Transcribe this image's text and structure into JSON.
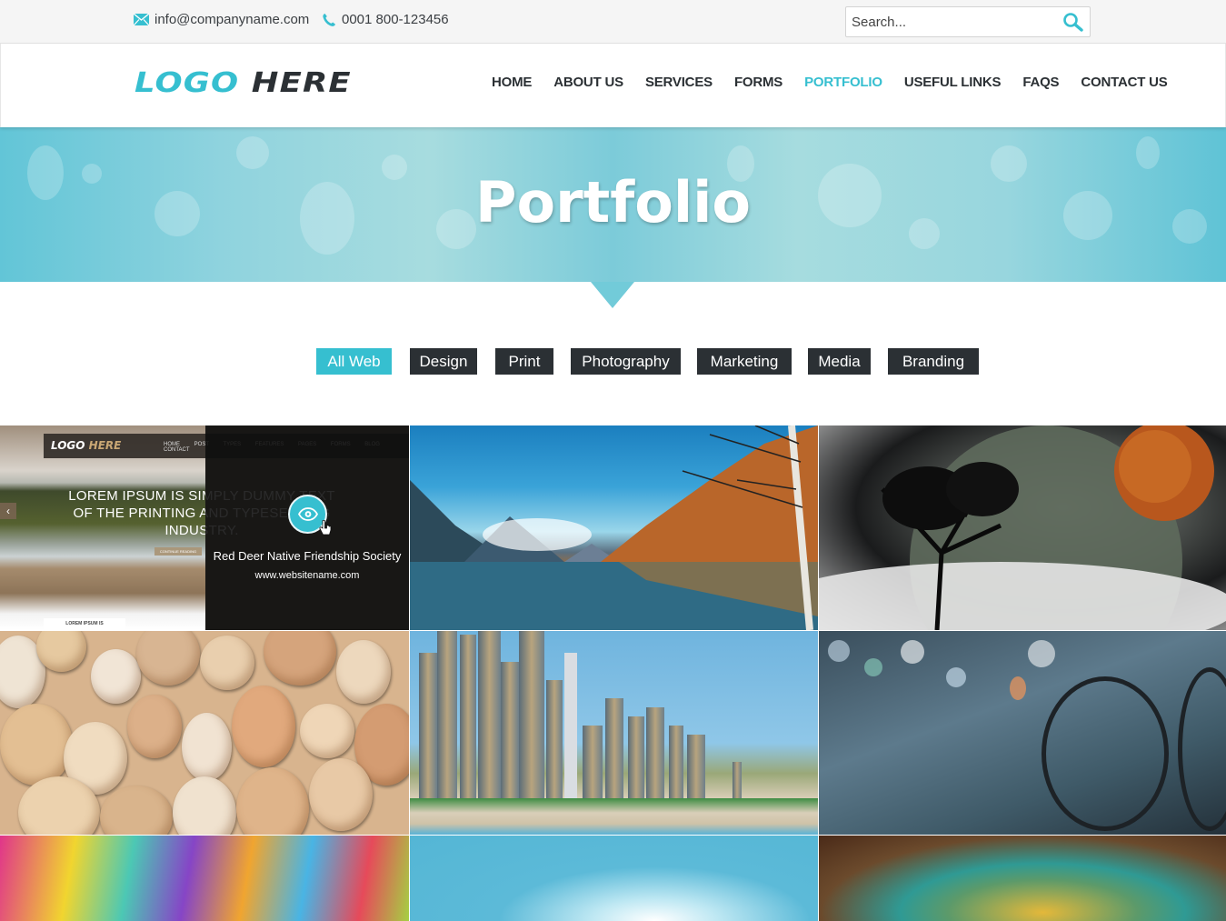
{
  "topbar": {
    "email": "info@companyname.com",
    "phone": "0001 800-123456",
    "search_placeholder": "Search..."
  },
  "brand": {
    "logo_part1": "LOGO",
    "logo_part2": "HERE",
    "accent_color": "#36bfd0",
    "dark_color": "#2b3034"
  },
  "nav": {
    "items": [
      {
        "label": "HOME",
        "active": false
      },
      {
        "label": "ABOUT US",
        "active": false
      },
      {
        "label": "SERVICES",
        "active": false
      },
      {
        "label": "FORMS",
        "active": false
      },
      {
        "label": "PORTFOLIO",
        "active": true
      },
      {
        "label": "USEFUL LINKS",
        "active": false
      },
      {
        "label": "FAQS",
        "active": false
      },
      {
        "label": "CONTACT US",
        "active": false
      }
    ]
  },
  "hero": {
    "title": "Portfolio"
  },
  "filters": {
    "items": [
      {
        "label": "All Web",
        "active": true
      },
      {
        "label": "Design",
        "active": false
      },
      {
        "label": "Print",
        "active": false
      },
      {
        "label": "Photography",
        "active": false
      },
      {
        "label": "Marketing",
        "active": false
      },
      {
        "label": "Media",
        "active": false
      },
      {
        "label": "Branding",
        "active": false
      }
    ]
  },
  "portfolio": {
    "featured": {
      "mock_logo_part1": "LOGO",
      "mock_logo_part2": "HERE",
      "mock_nav": "HOME POST TYPES FEATURES PAGES FORMS BLOG CONTACT",
      "mock_headline": "LOREM IPSUM IS SIMPLY DUMMY TEXT OF THE PRINTING AND TYPESETTING INDUSTRY.",
      "mock_cta": "CONTINUE READING",
      "mock_card": "LOREM IPSUM IS",
      "overlay_title": "Red Deer Native Friendship Society",
      "overlay_url": "www.websitename.com"
    },
    "tiles": [
      {
        "subject": "website-screenshot"
      },
      {
        "subject": "mountain-lake"
      },
      {
        "subject": "planet-and-tree"
      },
      {
        "subject": "pebbles"
      },
      {
        "subject": "city-skyline-beach"
      },
      {
        "subject": "bicycle-street-bokeh"
      },
      {
        "subject": "colorful-powder"
      },
      {
        "subject": "light-sparkles"
      },
      {
        "subject": "fractal"
      }
    ]
  }
}
